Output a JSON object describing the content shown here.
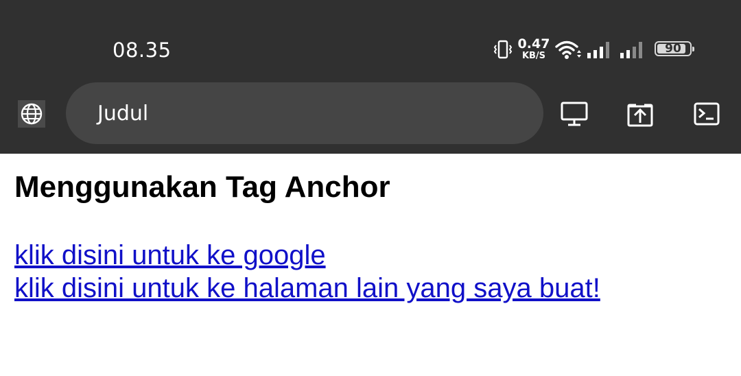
{
  "status_bar": {
    "time": "08.35",
    "net_speed": "0.47",
    "net_speed_unit": "KB/S",
    "battery_level": "90",
    "icons": [
      "vibrate-icon",
      "wifi-icon",
      "signal-icon",
      "signal-icon",
      "battery-icon"
    ]
  },
  "toolbar": {
    "site_icon": "globe-icon",
    "title": "Judul",
    "buttons": [
      "desktop-icon",
      "open-external-icon",
      "terminal-icon"
    ]
  },
  "page": {
    "heading": "Menggunakan Tag Anchor",
    "links": [
      "klik disini untuk ke google",
      "klik disini untuk ke halaman lain yang saya buat!"
    ]
  },
  "colors": {
    "chrome_bg": "#303030",
    "address_bg": "#454545",
    "link": "#1010c8",
    "page_bg": "#ffffff"
  }
}
